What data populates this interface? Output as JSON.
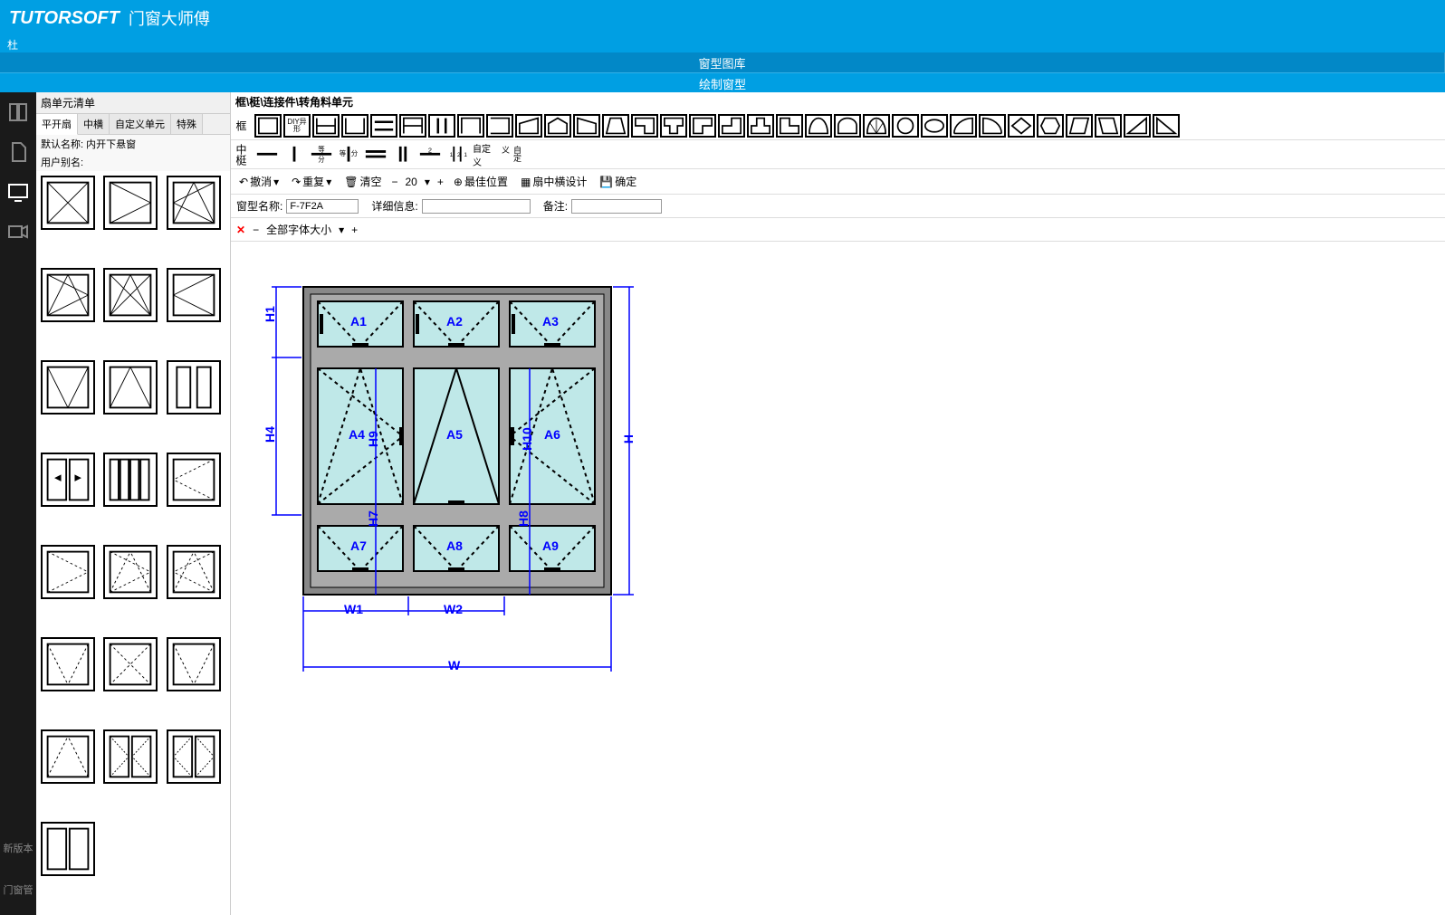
{
  "header": {
    "logo": "TUTORSOFT",
    "product": "门窗大师傅",
    "menu_left": "杜"
  },
  "tabs": {
    "main": "窗型图库",
    "sub": "绘制窗型"
  },
  "sidebar": {
    "title": "扇单元清单",
    "tabs": [
      {
        "label": "平开扇",
        "active": true
      },
      {
        "label": "中横",
        "active": false
      },
      {
        "label": "自定义单元",
        "active": false
      },
      {
        "label": "特殊",
        "active": false
      }
    ],
    "default_name_label": "默认名称:",
    "default_name_value": "内开下悬窗",
    "user_alias_label": "用户别名:"
  },
  "breadcrumb": "框\\梃\\连接件\\转角料单元",
  "toolbar": {
    "row1_label": "框",
    "row2_label": "中梃",
    "diy_label": "DIY异形",
    "deng_label": "等",
    "fen_label": "分",
    "custom_label": "自定义"
  },
  "actions": {
    "undo": "撤消",
    "redo": "重复",
    "clear": "清空",
    "zoom_value": "20",
    "best_pos": "最佳位置",
    "fan_design": "扇中横设计",
    "confirm": "确定"
  },
  "form": {
    "name_label": "窗型名称:",
    "name_value": "F-7F2A",
    "detail_label": "详细信息:",
    "detail_value": "",
    "remark_label": "备注:",
    "remark_value": ""
  },
  "font_bar": {
    "all_font_label": "全部字体大小"
  },
  "drawing": {
    "labels": {
      "H1": "H1",
      "H4": "H4",
      "H": "H",
      "H7": "H7",
      "H8": "H8",
      "H9": "H9",
      "H10": "H10",
      "W1": "W1",
      "W2": "W2",
      "W": "W",
      "A1": "A1",
      "A2": "A2",
      "A3": "A3",
      "A4": "A4",
      "A5": "A5",
      "A6": "A6",
      "A7": "A7",
      "A8": "A8",
      "A9": "A9"
    }
  },
  "footer": {
    "new_version": "新版本",
    "manage": "门窗管"
  }
}
